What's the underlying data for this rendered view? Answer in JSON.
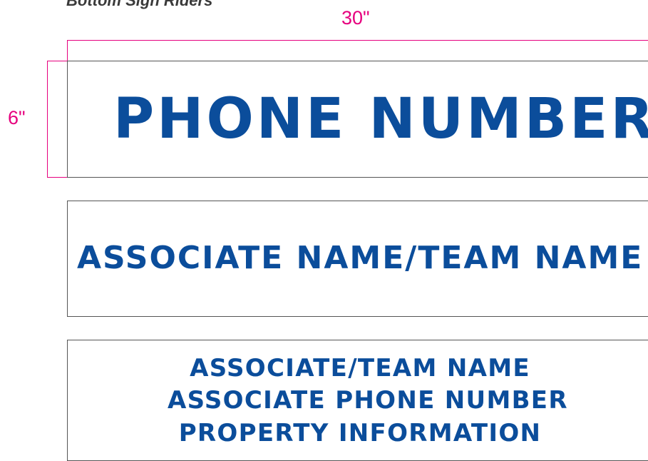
{
  "section_title": "Bottom Sign Riders",
  "dimensions": {
    "width_label": "30\"",
    "height_label": "6\"",
    "accent_color": "#e6007e"
  },
  "text_color": "#0b4d9b",
  "signs": [
    {
      "lines": [
        "PHONE NUMBER"
      ]
    },
    {
      "lines": [
        "ASSOCIATE NAME/TEAM NAME"
      ]
    },
    {
      "lines": [
        "ASSOCIATE/TEAM NAME",
        "ASSOCIATE PHONE NUMBER",
        "PROPERTY INFORMATION"
      ]
    }
  ]
}
